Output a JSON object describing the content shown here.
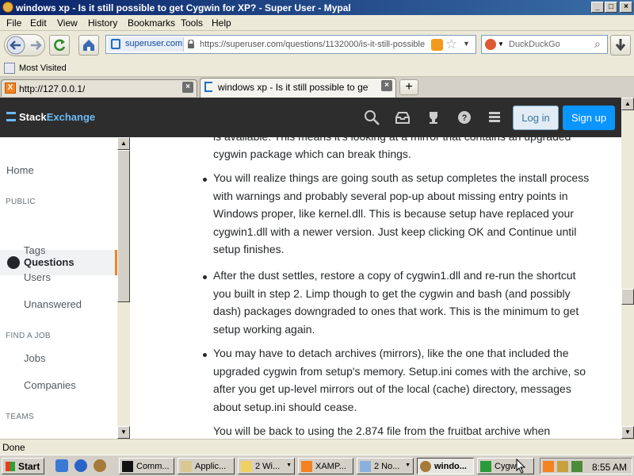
{
  "window": {
    "title": "windows xp - Is it still possible to get Cygwin for XP? - Super User - Mypal"
  },
  "menu": [
    "File",
    "Edit",
    "View",
    "History",
    "Bookmarks",
    "Tools",
    "Help"
  ],
  "menu_hotkeys": [
    "F",
    "E",
    "V",
    "H",
    "B",
    "T",
    "H"
  ],
  "nav": {
    "identity_label": "superuser.com",
    "url": "https://superuser.com/questions/1132000/is-it-still-possible",
    "search_engine": "DuckDuckGo"
  },
  "bookmarks": {
    "most_visited": "Most Visited"
  },
  "tabs": [
    {
      "label": "http://127.0.0.1/"
    },
    {
      "label": "windows xp - Is it still possible to get Cyg..."
    }
  ],
  "site": {
    "logo_stack": "Stack",
    "logo_exchange": "Exchange",
    "login_label": "Log in",
    "signup_label": "Sign up",
    "accent": "#f48225"
  },
  "leftnav": {
    "home": "Home",
    "public_heading": "PUBLIC",
    "questions": "Questions",
    "tags": "Tags",
    "users": "Users",
    "unanswered": "Unanswered",
    "find_job_heading": "FIND A JOB",
    "jobs": "Jobs",
    "companies": "Companies",
    "teams_heading": "TEAMS"
  },
  "article": {
    "partial_top_1": "is available. This means it's looking at a mirror that contains an upgraded",
    "partial_top_2": "cygwin package which can break things.",
    "bullets": [
      "You will realize things are going south as setup completes the install process with warnings and probably several pop-up about missing entry points in Windows proper, like kernel.dll. This is because setup have replaced your cygwin1.dll with a newer version. Just keep clicking OK and Continue until setup finishes.",
      "After the dust settles, restore a copy of cygwin1.dll and re-run the shortcut you built in step 2. Limp though to get the cygwin and bash (and possibly dash) packages downgraded to ones that work. This is the minimum to get setup working again.",
      "You may have to detach archives (mirrors), like the one that included the upgraded cygwin from setup's memory. Setup.ini comes with the archive, so after you get up-level mirrors out of the local (cache) directory, messages about setup.ini should cease."
    ],
    "trailing": "You will be back to using the 2.874 file from the fruitbat archive when"
  },
  "status": {
    "text": "Done"
  },
  "taskbar": {
    "start_label": "Start",
    "tasks": [
      "Comm...",
      "Applic...",
      "2 Wi...",
      "XAMP...",
      "2 No...",
      "windo...",
      "Cygw..."
    ],
    "active_index": 5,
    "clock": "8:55 AM"
  }
}
